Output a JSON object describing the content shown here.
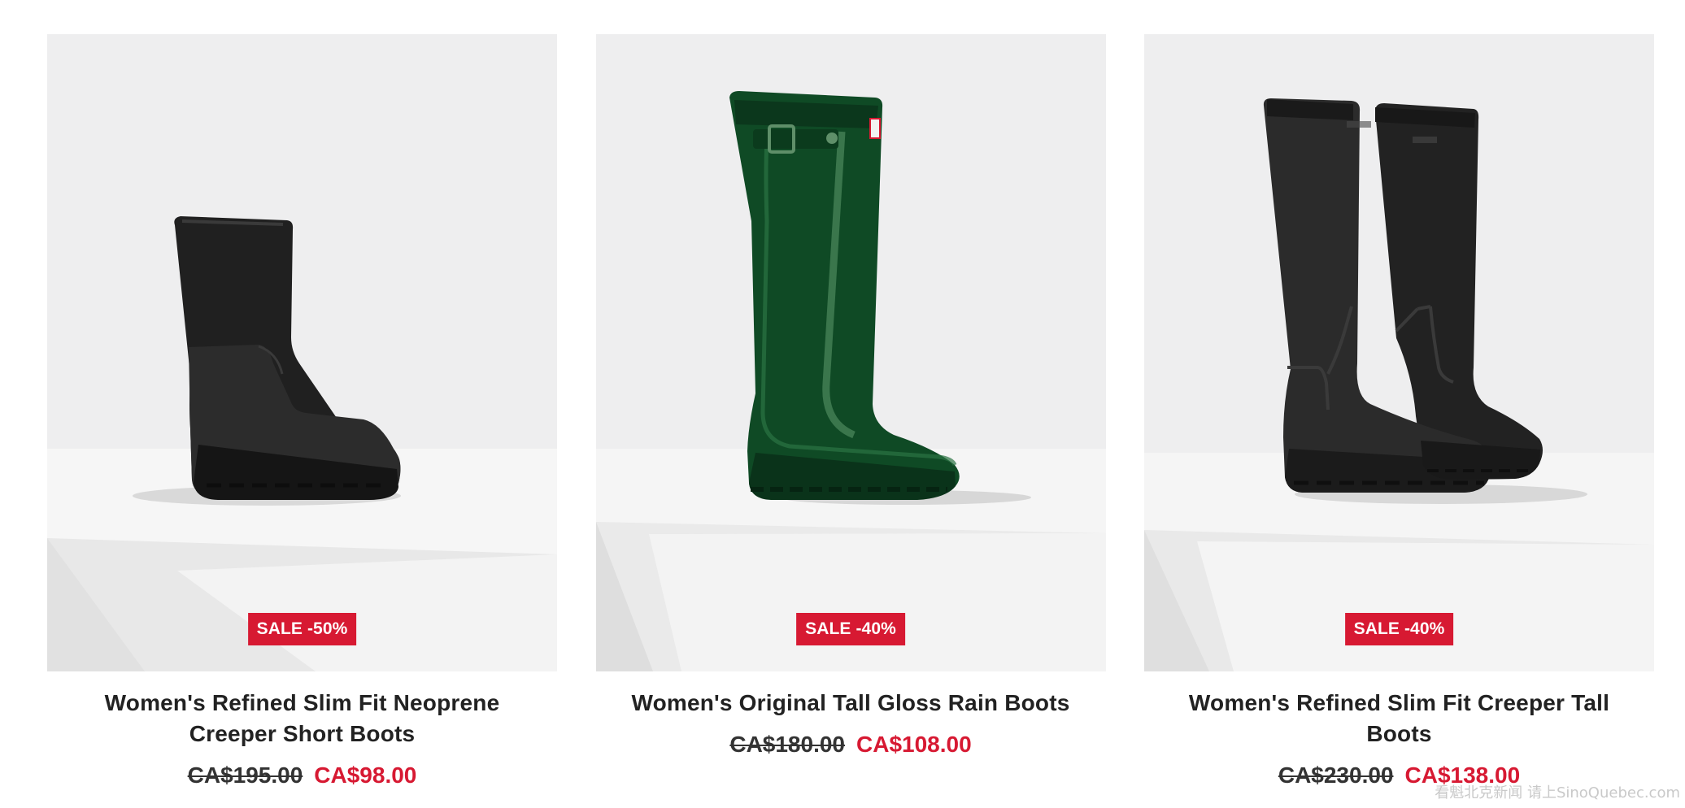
{
  "products": [
    {
      "image_alt": "Women's Refined Slim Fit Neoprene Creeper Short Boots",
      "boot_color": "#1c1c1c",
      "badge": "SALE -50%",
      "title": "Women's Refined Slim Fit Neoprene Creeper Short Boots",
      "old_price": "CA$195.00",
      "sale_price": "CA$98.00"
    },
    {
      "image_alt": "Women's Original Tall Gloss Rain Boots",
      "boot_color": "#0f4a25",
      "badge": "SALE -40%",
      "title": "Women's Original Tall Gloss Rain Boots",
      "old_price": "CA$180.00",
      "sale_price": "CA$108.00"
    },
    {
      "image_alt": "Women's Refined Slim Fit Creeper Tall Boots",
      "boot_color": "#2a2a2a",
      "badge": "SALE -40%",
      "title": "Women's Refined Slim Fit Creeper Tall Boots",
      "old_price": "CA$230.00",
      "sale_price": "CA$138.00"
    }
  ],
  "watermark": "看魁北克新闻 请上SinoQuebec.com",
  "colors": {
    "sale_red": "#d71932",
    "panel_bg": "#efefef",
    "text": "#222222"
  }
}
